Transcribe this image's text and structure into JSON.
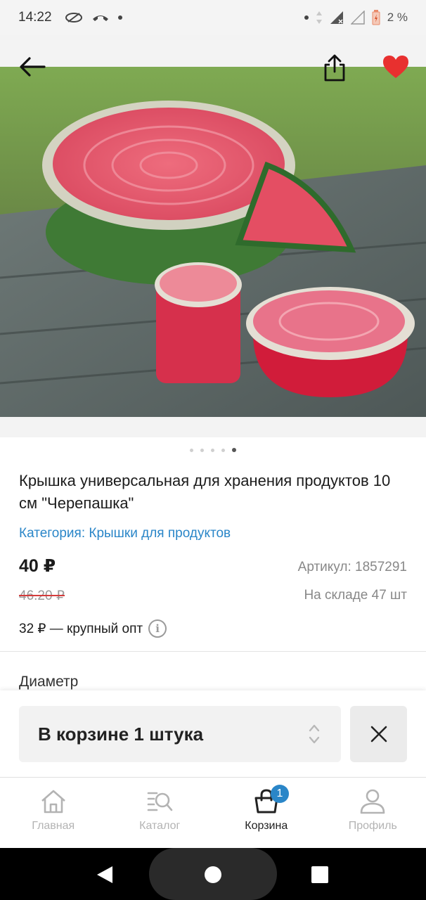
{
  "status_bar": {
    "time": "14:22",
    "battery": "2 %"
  },
  "product": {
    "title": "Крышка универсальная для хранения продуктов 10 см \"Черепашка\"",
    "category": "Категория: Крышки для продуктов",
    "price": "40 ₽",
    "old_price": "46.20 ₽",
    "sku": "Артикул: 1857291",
    "stock": "На складе 47 шт",
    "wholesale": "32 ₽ — крупный опт",
    "option_label": "Диаметр"
  },
  "gallery": {
    "pages": 5,
    "active_page": 5
  },
  "cart": {
    "quantity_label": "В корзине 1 штука"
  },
  "bottom_nav": {
    "items": [
      {
        "label": "Главная",
        "icon": "home-icon"
      },
      {
        "label": "Каталог",
        "icon": "catalog-search-icon"
      },
      {
        "label": "Корзина",
        "icon": "cart-bag-icon",
        "badge": "1",
        "active": true
      },
      {
        "label": "Профиль",
        "icon": "profile-icon"
      }
    ]
  },
  "colors": {
    "accent": "#2a86c8",
    "favorite": "#e8302f",
    "strike": "#d43c3c"
  }
}
